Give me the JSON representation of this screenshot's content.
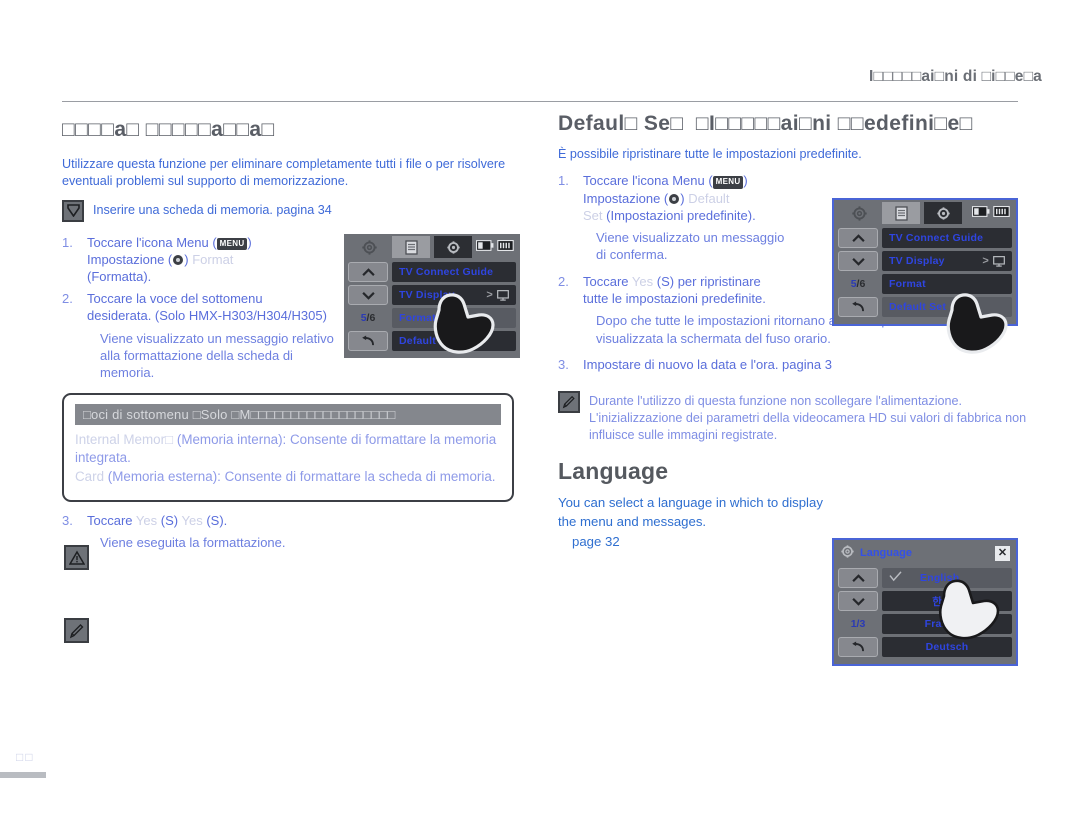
{
  "running_head": "I□□□□□ai□ni di □i□□e□a",
  "left": {
    "section_title": "□□□□a□ □□□□□a□□a□",
    "lead": "Utilizzare questa funzione per eliminare completamente tutti i file o per risolvere eventuali problemi sul supporto di memorizzazione.",
    "note_insert_card": "Inserire una scheda di memoria. pagina 34",
    "note_icon": "card-insert-icon",
    "steps": [
      {
        "num": "1.",
        "line1_pre": "Toccare l'icona Menu (",
        "menu_pill": "MENU",
        "line1_post": ")",
        "line2_pre": "Impostazione (",
        "gear": "gear-icon",
        "line2_mid": ")",
        "line2_faint": "Format",
        "line3": "(Formatta)."
      },
      {
        "num": "2.",
        "line1": "Toccare la voce del sottomenu",
        "line2": "desiderata. (Solo HMX-H303/H304/H305)",
        "sub": "Viene visualizzato un messaggio relativo alla formattazione della scheda di memoria."
      },
      {
        "num": "3.",
        "line1_pre": "Toccare",
        "faint1": "Yes",
        "mid1": "(S)",
        "faint2": "Yes",
        "mid2": "(S).",
        "sub": "Viene eseguita la formattazione."
      }
    ],
    "submenu_box": {
      "header": "□oci di sottomenu □Solo □M□□□□□□□□□□□□□□□□□□",
      "items": [
        {
          "ghost": "Internal Memor□",
          "text": "(Memoria interna): Consente di formattare la memoria integrata."
        },
        {
          "ghost": "Card",
          "text": "(Memoria esterna): Consente di formattare la scheda di memoria."
        }
      ]
    },
    "margin_icons": [
      {
        "name": "warning-triangle-icon"
      },
      {
        "name": "note-pencil-icon"
      }
    ]
  },
  "right": {
    "section_title": "Defaul□ Se□  □I□□□□□ai□ni □□edefini□e□",
    "lead": "È possibile ripristinare tutte le impostazioni predefinite.",
    "steps": [
      {
        "num": "1.",
        "line1_pre": "Toccare l'icona Menu (",
        "menu_pill": "MENU",
        "line1_post": ")",
        "line2_pre": "Impostazione (",
        "gear": "gear-icon",
        "line2_mid": ")",
        "line2_faint": "Default",
        "line3_faint": "Set",
        "line3": "(Impostazioni predefinite).",
        "sub": "Viene visualizzato un messaggio di conferma."
      },
      {
        "num": "2.",
        "line1_pre": "Toccare",
        "faint1": "Yes",
        "line1_post": "(S) per ripristinare",
        "line2": "tutte le impostazioni predefinite.",
        "sub": "Dopo che tutte le impostazioni ritornano al valore predefinito viene visualizzata la schermata del fuso orario."
      },
      {
        "num": "3.",
        "line1": "Impostare di nuovo la data e l'ora.  pagina 3"
      }
    ],
    "note": {
      "icon": "note-pencil-icon",
      "text": "Durante l'utilizzo di questa funzione non scollegare l'alimentazione. L'inizializzazione dei parametri della videocamera HD sui valori di fabbrica non influisce sulle immagini registrate."
    },
    "language": {
      "title": "Language",
      "body": "You can select a language in which to display the menu and messages.",
      "page_ref": "page 32"
    }
  },
  "lcd_format": {
    "name": "format-menu-screen",
    "tabs": [
      "gear-outline-icon",
      "list-icon",
      "gear-filled-icon"
    ],
    "battery": "battery-icon",
    "signal": "level-icon",
    "page_indicator_current": "5",
    "page_indicator_total": "/6",
    "up_arrow": "chevron-up-icon",
    "down_arrow": "chevron-down-icon",
    "back_arrow": "back-arrow-icon",
    "items": [
      {
        "label": "TV Connect Guide",
        "selected": false,
        "right": ""
      },
      {
        "label": "TV Display",
        "selected": false,
        "right": "> ☐"
      },
      {
        "label": "Format",
        "selected": true,
        "right": ""
      },
      {
        "label": "Default Set",
        "selected": false,
        "right": ""
      }
    ],
    "cursor": "hand-pointer-icon"
  },
  "lcd_default": {
    "name": "default-set-menu-screen",
    "tabs": [
      "gear-outline-icon",
      "list-icon",
      "gear-filled-icon"
    ],
    "page_indicator_current": "5",
    "page_indicator_total": "/6",
    "items": [
      {
        "label": "TV Connect Guide",
        "selected": false,
        "right": ""
      },
      {
        "label": "TV Display",
        "selected": false,
        "right": "> ☐"
      },
      {
        "label": "Format",
        "selected": false,
        "right": ""
      },
      {
        "label": "Default Set",
        "selected": true,
        "right": ""
      }
    ],
    "cursor": "hand-pointer-icon"
  },
  "lcd_language": {
    "name": "language-menu-screen",
    "title": "Language",
    "close": "close-icon",
    "page_indicator_current": "1",
    "page_indicator_total": "/3",
    "items": [
      {
        "label": "English",
        "selected": true,
        "check": "check-icon"
      },
      {
        "label": "한국어",
        "selected": false,
        "check": ""
      },
      {
        "label": "Français",
        "selected": false,
        "check": ""
      },
      {
        "label": "Deutsch",
        "selected": false,
        "check": ""
      }
    ],
    "cursor": "hand-pointer-icon"
  },
  "footer": {
    "page_number": "□□"
  },
  "colors": {
    "link_blue": "#3f6ad8",
    "step_blue": "#5a6edb",
    "heading_grey": "#5a5e66",
    "lcd_grey": "#6d7076",
    "lcd_item_dark": "#2b2d33",
    "lcd_text_blue": "#2f45e0",
    "frame_blue": "#4a64d6"
  }
}
